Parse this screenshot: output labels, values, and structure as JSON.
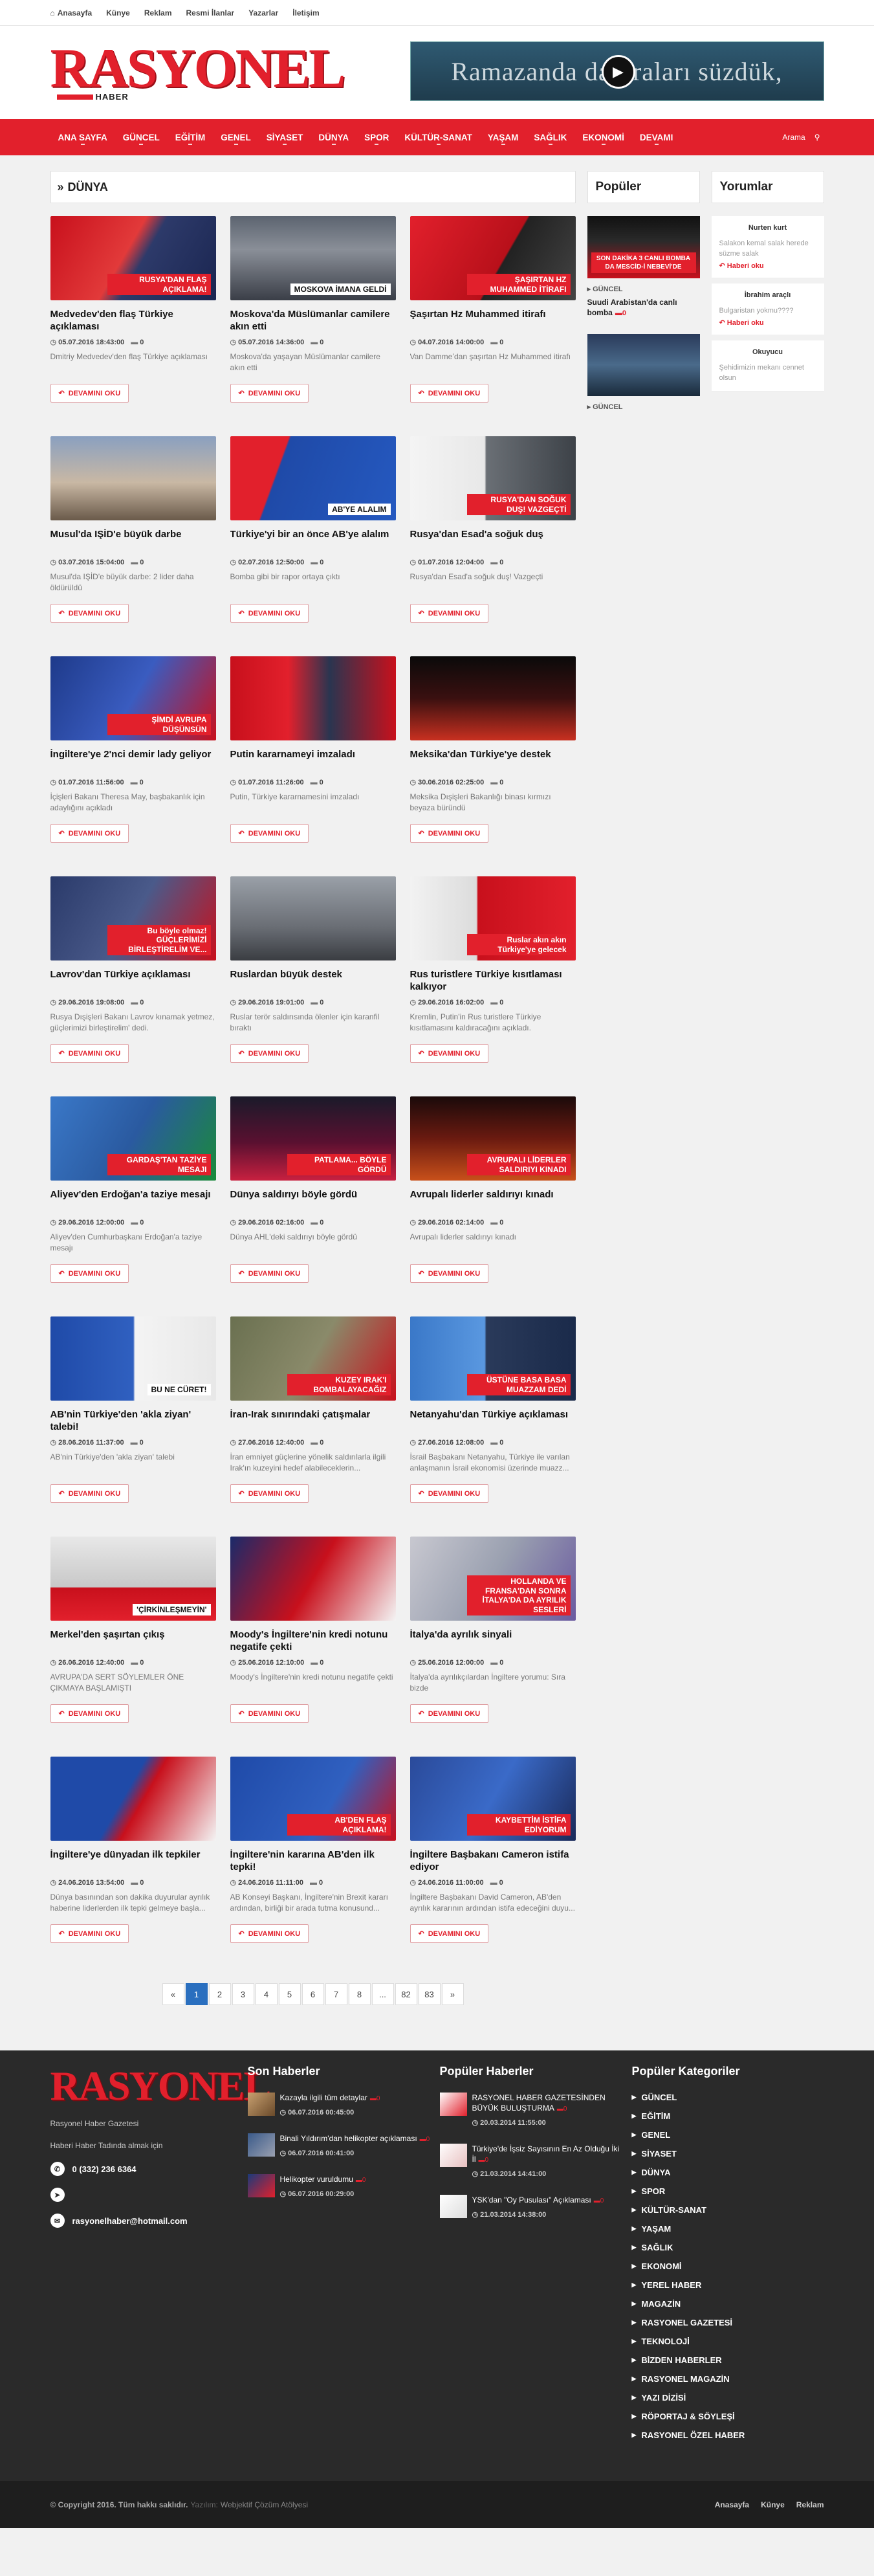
{
  "topbar": {
    "items": [
      "Anasayfa",
      "Künye",
      "Reklam",
      "Resmi İlanlar",
      "Yazarlar",
      "İletişim"
    ]
  },
  "logo": {
    "name": "RASYONEL",
    "sub": "HABER"
  },
  "banner": {
    "text": "Ramazanda da Traları süzdük,"
  },
  "nav": {
    "items": [
      "ANA SAYFA",
      "GÜNCEL",
      "EĞİTİM",
      "GENEL",
      "SİYASET",
      "DÜNYA",
      "SPOR",
      "KÜLTÜR-SANAT",
      "YAŞAM",
      "SAĞLIK",
      "EKONOMİ",
      "DEVAMI"
    ],
    "search_label": "Arama"
  },
  "section": {
    "title": "DÜNYA"
  },
  "readmore_label": "DEVAMINI OKU",
  "articles": [
    {
      "title": "Medvedev'den flaş Türkiye açıklaması",
      "date": "05.07.2016 18:43:00",
      "comments": "0",
      "excerpt": "Dmitriy Medvedev'den flaş Türkiye açıklaması",
      "caption": "RUSYA'DAN FLAŞ AÇIKLAMA!",
      "bg": "linear-gradient(120deg,#c8101c 0%,#e23a3a 45%,#2d3a6a 55%,#1a2550 100%)"
    },
    {
      "title": "Moskova'da Müslümanlar camilere akın etti",
      "date": "05.07.2016 14:36:00",
      "comments": "0",
      "excerpt": "Moskova'da yaşayan Müslümanlar camilere akın etti",
      "caption": "MOSKOVA İMANA GELDİ",
      "bg": "linear-gradient(180deg,#5c6470 0%,#8a8f98 40%,#3a3e47 100%)"
    },
    {
      "title": "Şaşırtan Hz Muhammed itirafı",
      "date": "04.07.2016 14:00:00",
      "comments": "0",
      "excerpt": "Van Dammeʼdan şaşırtan Hz Muhammed itirafı",
      "caption": "ŞAŞIRTAN HZ MUHAMMED İTİRAFI",
      "bg": "linear-gradient(120deg,#e2202c 0%,#b8101a 55%,#222 56%,#444 100%)"
    },
    {
      "title": "Musul'da IŞİD'e büyük darbe",
      "date": "03.07.2016 15:04:00",
      "comments": "0",
      "excerpt": "Musul'da IŞİD'e büyük darbe: 2 lider daha öldürüldü",
      "caption": "",
      "bg": "linear-gradient(180deg,#8aa0c0 0%,#c9b8a4 55%,#6a5a4a 100%)"
    },
    {
      "title": "Türkiye'yi bir an önce AB'ye alalım",
      "date": "02.07.2016 12:50:00",
      "comments": "0",
      "excerpt": "Bomba gibi bir rapor ortaya çıktı",
      "caption": "AB'YE ALALIM",
      "bg": "linear-gradient(110deg,#e2202c 0%,#e2202c 30%,#1f4aa8 31%,#2559c0 100%)"
    },
    {
      "title": "Rusya'dan Esad'a soğuk duş",
      "date": "01.07.2016 12:04:00",
      "comments": "0",
      "excerpt": "Rusya'dan Esad'a soğuk duş! Vazgeçti",
      "caption": "RUSYA'DAN SOĞUK DUŞ! VAZGEÇTİ",
      "bg": "linear-gradient(90deg,#f4f4f4 0%,#e8e8e8 45%,#6a6f75 46%,#3d4248 100%)"
    },
    {
      "title": "İngiltere'ye 2'nci demir lady geliyor",
      "date": "01.07.2016 11:56:00",
      "comments": "0",
      "excerpt": "İçişleri Bakanı Theresa May, başbakanlık için adaylığını açıkladı",
      "caption": "ŞİMDİ AVRUPA DÜŞÜNSÜN",
      "bg": "linear-gradient(120deg,#1e3a8a 0%,#3a5cc0 50%,#c8101c 100%)"
    },
    {
      "title": "Putin kararnameyi imzaladı",
      "date": "01.07.2016 11:26:00",
      "comments": "0",
      "excerpt": "Putin, Türkiye kararnamesini imzaladı",
      "caption": "",
      "bg": "linear-gradient(90deg,#c8101c 0%,#e2202c 35%,#2a3550 60%,#c8101c 100%)"
    },
    {
      "title": "Meksika'dan Türkiye'ye destek",
      "date": "30.06.2016 02:25:00",
      "comments": "0",
      "excerpt": "Meksika Dışişleri Bakanlığı binası kırmızı beyaza büründü",
      "caption": "",
      "bg": "linear-gradient(180deg,#0a0a0a 0%,#3a1010 50%,#c83020 100%)"
    },
    {
      "title": "Lavrov'dan Türkiye açıklaması",
      "date": "29.06.2016 19:08:00",
      "comments": "0",
      "excerpt": "Rusya Dışişleri Bakanı Lavrov kınamak yetmez, güçlerimizi birleştirelim' dedi.",
      "caption": "Bu böyle olmaz! GÜÇLERİMİZİ BİRLEŞTİRELİM VE...",
      "bg": "linear-gradient(120deg,#2a3a6a 0%,#4a5a8a 50%,#c8101c 100%)"
    },
    {
      "title": "Ruslardan büyük destek",
      "date": "29.06.2016 19:01:00",
      "comments": "0",
      "excerpt": "Ruslar terör saldırısında ölenler için karanfil bıraktı",
      "caption": "",
      "bg": "linear-gradient(180deg,#9aa0a8 0%,#6a6e75 60%,#3a3d42 100%)"
    },
    {
      "title": "Rus turistlere Türkiye kısıtlaması kalkıyor",
      "date": "29.06.2016 16:02:00",
      "comments": "0",
      "excerpt": "Kremlin, Putin'in Rus turistlere Türkiye kısıtlamasını kaldıracağını açıkladı.",
      "caption": "Ruslar akın akın Türkiye'ye gelecek",
      "bg": "linear-gradient(90deg,#f2f2f2 0%,#dcdcdc 40%,#c8101c 41%,#e2202c 100%)"
    },
    {
      "title": "Aliyev'den Erdoğan'a taziye mesajı",
      "date": "29.06.2016 12:00:00",
      "comments": "0",
      "excerpt": "Aliyev'den Cumhurbaşkanı Erdoğan'a taziye mesajı",
      "caption": "GARDAŞ'TAN TAZİYE MESAJI",
      "bg": "linear-gradient(120deg,#3a78c8 0%,#2a5aa0 50%,#1a8a3a 100%)"
    },
    {
      "title": "Dünya saldırıyı böyle gördü",
      "date": "29.06.2016 02:16:00",
      "comments": "0",
      "excerpt": "Dünya AHL'deki saldırıyı böyle gördü",
      "caption": "PATLAMA... BÖYLE GÖRDÜ",
      "bg": "linear-gradient(180deg,#1a1a2a 0%,#5a1030 55%,#c82040 100%)"
    },
    {
      "title": "Avrupalı liderler saldırıyı kınadı",
      "date": "29.06.2016 02:14:00",
      "comments": "0",
      "excerpt": "Avrupalı liderler saldırıyı kınadı",
      "caption": "AVRUPALI LİDERLER SALDIRIYI KINADI",
      "bg": "linear-gradient(180deg,#1a0a0a 0%,#6a1a10 50%,#c8501a 100%)"
    },
    {
      "title": "AB'nin Türkiye'den 'akla ziyan' talebi!",
      "date": "28.06.2016 11:37:00",
      "comments": "0",
      "excerpt": "AB'nin Türkiye'den 'akla ziyan' talebi",
      "caption": "BU NE CÜRET!",
      "bg": "linear-gradient(90deg,#1f4aa8 0%,#3060c0 50%,#f4f4f4 51%,#e8e8e8 100%)"
    },
    {
      "title": "İran-Irak sınırındaki çatışmalar",
      "date": "27.06.2016 12:40:00",
      "comments": "0",
      "excerpt": "İran emniyet güçlerine yönelik saldırılarla ilgili Irak'ın kuzeyini hedef alabileceklerin...",
      "caption": "KUZEY IRAK'I BOMBALAYACAĞIZ",
      "bg": "linear-gradient(120deg,#6a7050 0%,#8a8a6a 50%,#c8101c 100%)"
    },
    {
      "title": "Netanyahu'dan Türkiye açıklaması",
      "date": "27.06.2016 12:08:00",
      "comments": "0",
      "excerpt": "İsrail Başbakanı Netanyahu, Türkiye ile varılan anlaşmanın İsrail ekonomisi üzerinde muazz...",
      "caption": "ÜSTÜNE BASA BASA MUAZZAM DEDİ",
      "bg": "linear-gradient(90deg,#3a78c8 0%,#5a98e0 45%,#2a3a5a 46%,#1a2a4a 100%)"
    },
    {
      "title": "Merkel'den şaşırtan çıkış",
      "date": "26.06.2016 12:40:00",
      "comments": "0",
      "excerpt": "AVRUPA'DA SERT SÖYLEMLER ÖNE ÇIKMAYA BAŞLAMIŞTI",
      "caption": "'ÇİRKİNLEŞMEYİN'",
      "bg": "linear-gradient(180deg,#e8e8e8 0%,#c8c8c8 60%,#c8101c 61%,#e2202c 100%)"
    },
    {
      "title": "Moody's İngiltere'nin kredi notunu negatife çekti",
      "date": "25.06.2016 12:10:00",
      "comments": "0",
      "excerpt": "Moody's İngiltere'nin kredi notunu negatife çekti",
      "caption": "",
      "bg": "linear-gradient(120deg,#1a2a6a 0%,#c8101c 50%,#f4f4f4 100%)"
    },
    {
      "title": "İtalya'da ayrılık sinyali",
      "date": "25.06.2016 12:00:00",
      "comments": "0",
      "excerpt": "İtalya'da ayrılıkçılardan İngiltere yorumu: Sıra bizde",
      "caption": "HOLLANDA VE FRANSA'DAN SONRA İTALYA'DA DA AYRILIK SESLERİ",
      "bg": "linear-gradient(120deg,#c8c8d0 0%,#9aa0b0 50%,#6a5aa0 100%)"
    },
    {
      "title": "İngiltere'ye dünyadan ilk tepkiler",
      "date": "24.06.2016 13:54:00",
      "comments": "0",
      "excerpt": "Dünya basınından son dakika duyurular ayrılık haberine liderlerden ilk tepki gelmeye başla...",
      "caption": "",
      "bg": "linear-gradient(120deg,#1f4aa8 0%,#1f4aa8 45%,#c8101c 55%,#f4f4f4 100%)"
    },
    {
      "title": "İngiltere'nin kararına AB'den ilk tepki!",
      "date": "24.06.2016 11:11:00",
      "comments": "0",
      "excerpt": "AB Konseyi Başkanı, İngiltere'nin Brexit kararı ardından, birliği bir arada tutma konusund...",
      "caption": "AB'DEN FLAŞ AÇIKLAMA!",
      "bg": "linear-gradient(120deg,#1f4aa8 0%,#3060c0 60%,#c8101c 100%)"
    },
    {
      "title": "İngiltere Başbakanı Cameron istifa ediyor",
      "date": "24.06.2016 11:00:00",
      "comments": "0",
      "excerpt": "İngiltere Başbakanı David Cameron, AB'den ayrılık kararının ardından istifa edeceğini duyu...",
      "caption": "KAYBETTİM İSTİFA EDİYORUM",
      "bg": "linear-gradient(120deg,#2a4a9a 0%,#3a6ac8 50%,#1a2a5a 100%)"
    }
  ],
  "pagination": [
    "«",
    "1",
    "2",
    "3",
    "4",
    "5",
    "6",
    "7",
    "8",
    "...",
    "82",
    "83",
    "»"
  ],
  "pagination_active": "1",
  "popular": {
    "title": "Popüler",
    "items": [
      {
        "category": "GÜNCEL",
        "title": "Suudi Arabistan'da canlı bomba",
        "comments": "0",
        "caption": "SON DAKİKA 3 CANLI BOMBA DA MESCİD-İ NEBEVİ'DE"
      },
      {
        "category": "GÜNCEL",
        "title": "",
        "comments": "",
        "caption": ""
      }
    ]
  },
  "comments_box": {
    "title": "Yorumlar",
    "items": [
      {
        "user": "Nurten kurt",
        "text": "Salakon kemal salak herede süzme salak",
        "link": "Haberi oku"
      },
      {
        "user": "İbrahim araçlı",
        "text": "Bulgaristan yokmu????",
        "link": "Haberi oku"
      },
      {
        "user": "Okuyucu",
        "text": "Şehidimizin mekanı cennet olsun",
        "link": ""
      }
    ]
  },
  "footer": {
    "logo": "RASYONEL",
    "desc": "Rasyonel Haber Gazetesi",
    "desc2": "Haberi Haber Tadında almak için",
    "phone": "0 (332) 236 6364",
    "email": "rasyonelhaber@hotmail.com",
    "latest_title": "Son Haberler",
    "latest": [
      {
        "title": "Kazayla ilgili tüm detaylar",
        "comments": "0",
        "date": "06.07.2016 00:45:00"
      },
      {
        "title": "Binali Yıldırım'dan helikopter açıklaması",
        "comments": "0",
        "date": "06.07.2016 00:41:00"
      },
      {
        "title": "Helikopter vuruldumu",
        "comments": "0",
        "date": "06.07.2016 00:29:00"
      }
    ],
    "popular_title": "Popüler Haberler",
    "popular": [
      {
        "title": "RASYONEL HABER GAZETESİNDEN BÜYÜK BULUŞTURMA",
        "comments": "0",
        "date": "20.03.2014 11:55:00"
      },
      {
        "title": "Türkiye'de İşsiz Sayısının En Az Olduğu İki İl",
        "comments": "0",
        "date": "21.03.2014 14:41:00"
      },
      {
        "title": "YSK'dan \"Oy Pusulası\" Açıklaması",
        "comments": "0",
        "date": "21.03.2014 14:38:00"
      }
    ],
    "categories_title": "Popüler Kategoriler",
    "categories": [
      "GÜNCEL",
      "EĞİTİM",
      "GENEL",
      "SİYASET",
      "DÜNYA",
      "SPOR",
      "KÜLTÜR-SANAT",
      "YAŞAM",
      "SAĞLIK",
      "EKONOMİ",
      "YEREL HABER",
      "MAGAZİN",
      "RASYONEL GAZETESİ",
      "TEKNOLOJİ",
      "BİZDEN HABERLER",
      "RASYONEL MAGAZİN",
      "YAZI DİZİSİ",
      "RÖPORTAJ & SÖYLEŞİ",
      "RASYONEL ÖZEL HABER"
    ]
  },
  "copyright": {
    "text": "© Copyright 2016. Tüm hakkı saklıdır.",
    "by": "Yazılım:",
    "company": "Webjektif Çözüm Atölyesi",
    "links": [
      "Anasayfa",
      "Künye",
      "Reklam"
    ]
  }
}
